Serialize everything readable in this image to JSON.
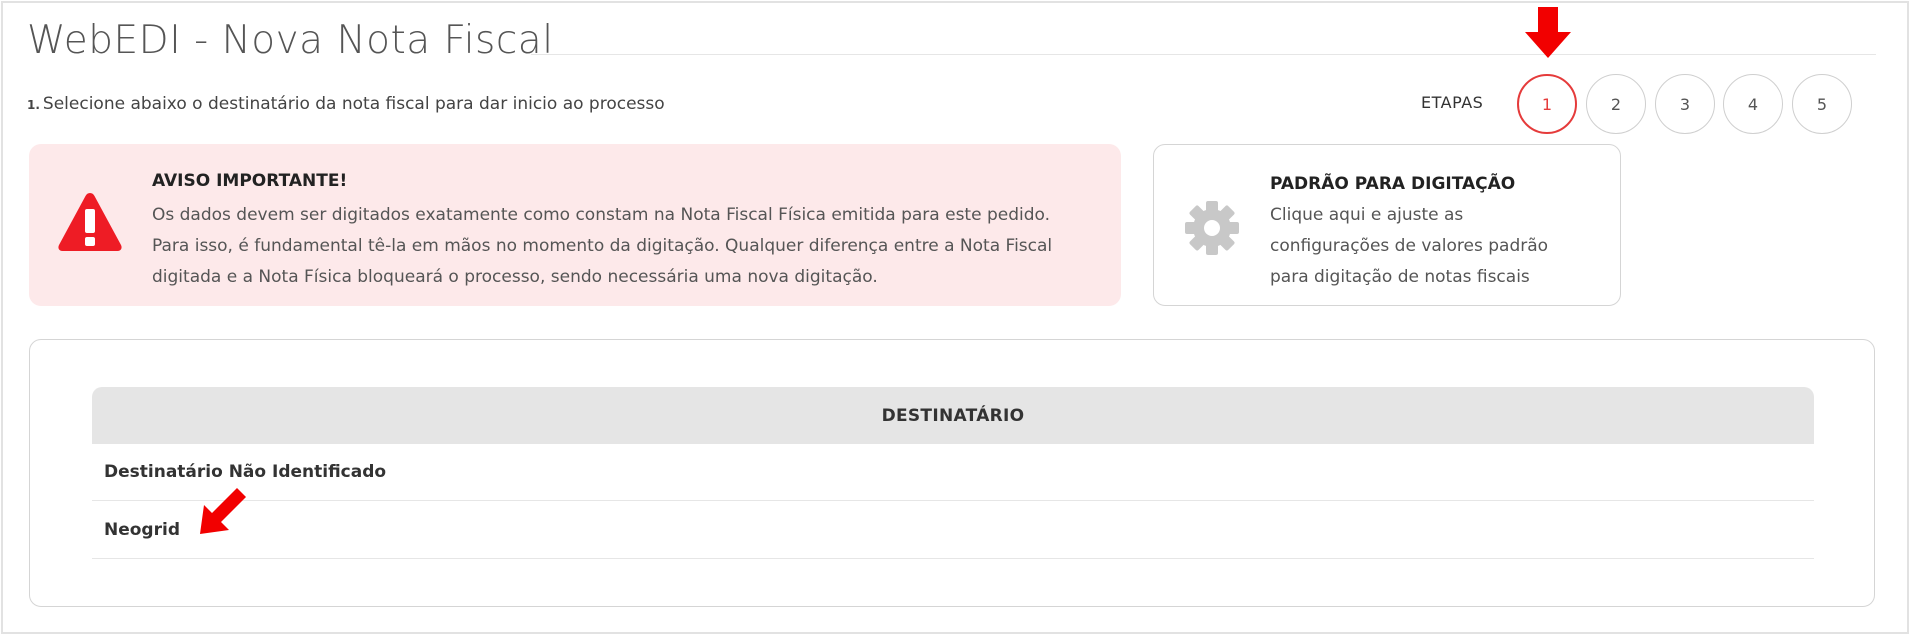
{
  "page": {
    "title": "WebEDI - Nova Nota Fiscal",
    "instruction_number": "1.",
    "instruction": "Selecione abaixo o destinatário da nota fiscal para dar inicio ao processo"
  },
  "steps": {
    "label": "ETAPAS",
    "items": [
      "1",
      "2",
      "3",
      "4",
      "5"
    ],
    "active": "1"
  },
  "alert": {
    "title": "AVISO IMPORTANTE!",
    "lines": [
      "Os dados devem ser digitados exatamente como constam na Nota Fiscal Física emitida para este pedido.",
      "Para isso, é fundamental tê-la em mãos no momento da digitação. Qualquer diferença entre a Nota Fiscal",
      "digitada e a Nota Física bloqueará o processo, sendo necessária uma nova digitação."
    ],
    "icon": "warning-triangle-icon"
  },
  "padrao": {
    "title": "PADRÃO PARA DIGITAÇÃO",
    "lines": [
      "Clique aqui e ajuste as",
      "configurações de valores padrão",
      "para digitação de notas fiscais"
    ],
    "icon": "gear-icon"
  },
  "table": {
    "header": "DESTINATÁRIO",
    "rows": [
      "Destinatário Não Identificado",
      "Neogrid"
    ]
  },
  "colors": {
    "accent_red": "#e53b3b",
    "alert_bg": "#fde9ea",
    "annotation_arrow": "#f20000",
    "gear_gray": "#c8c8c8"
  }
}
